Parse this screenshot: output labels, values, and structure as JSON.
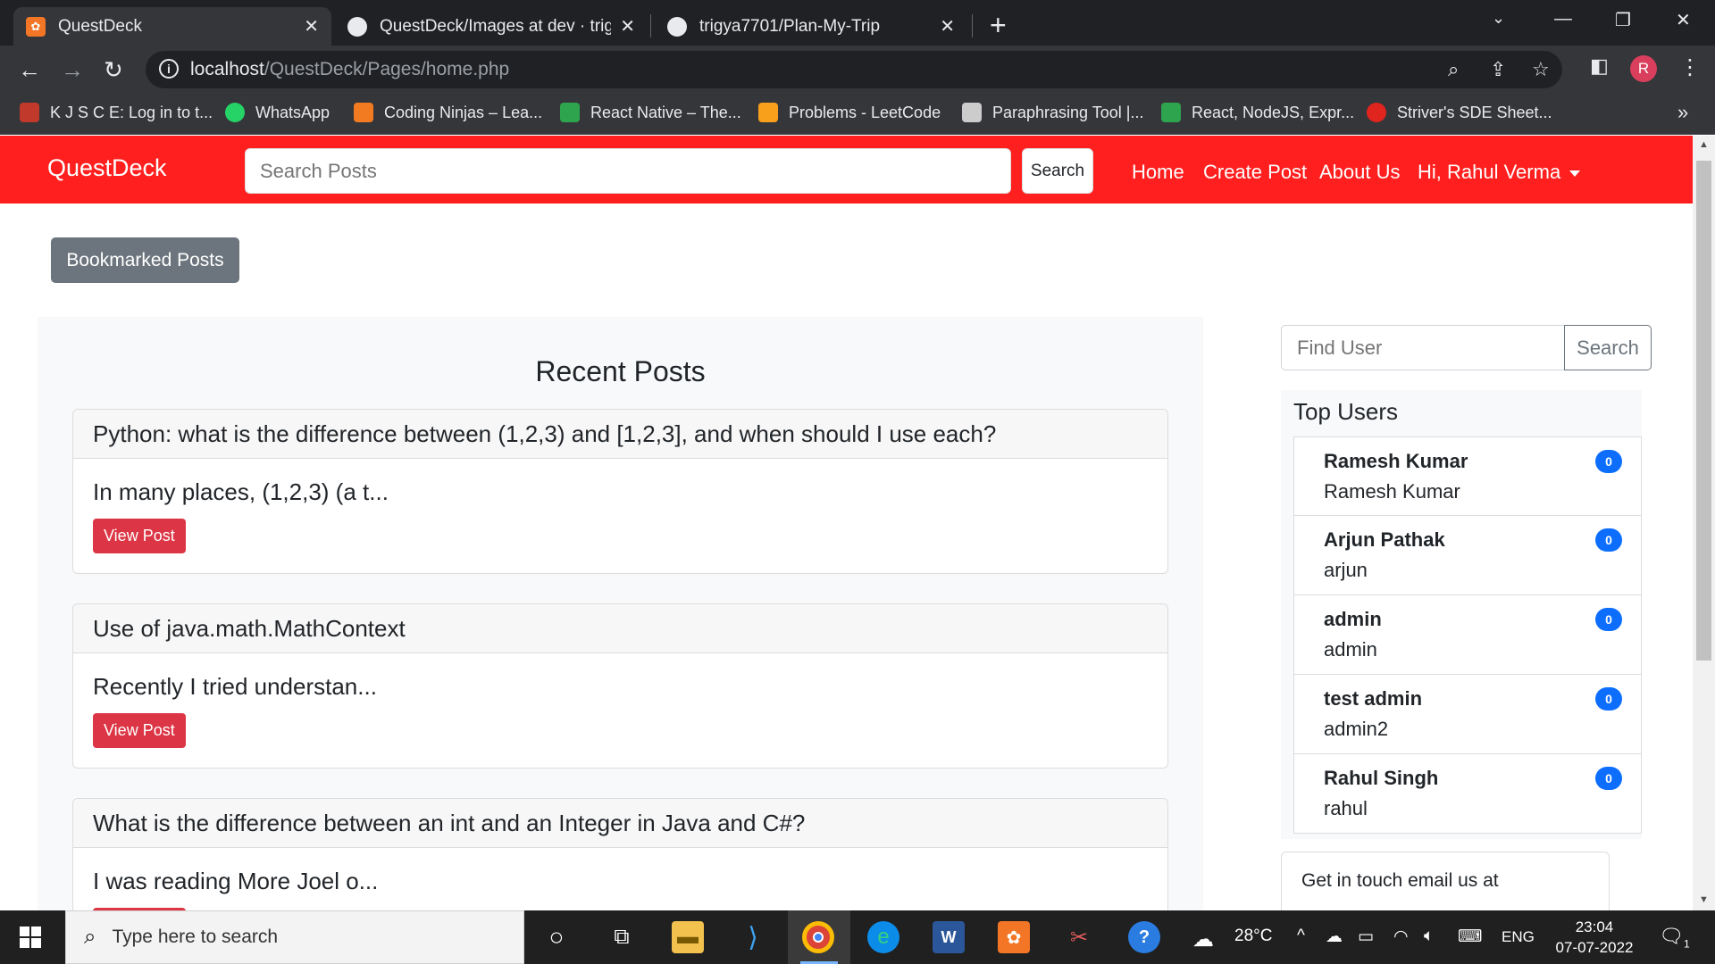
{
  "browser": {
    "tabs": [
      {
        "title": "QuestDeck",
        "active": true,
        "icon": "xampp-icon"
      },
      {
        "title": "QuestDeck/Images at dev · trigya",
        "active": false,
        "icon": "github-icon"
      },
      {
        "title": "trigya7701/Plan-My-Trip",
        "active": false,
        "icon": "github-icon"
      }
    ],
    "url_host": "localhost",
    "url_path": "/QuestDeck/Pages/home.php",
    "profile_initial": "R",
    "bookmarks": [
      {
        "label": "K J S C E: Log in to t...",
        "color": "#c0392b"
      },
      {
        "label": "WhatsApp",
        "color": "#25d366"
      },
      {
        "label": "Coding Ninjas – Lea...",
        "color": "#f27b21"
      },
      {
        "label": "React Native – The...",
        "color": "#2ea44f"
      },
      {
        "label": "Problems - LeetCode",
        "color": "#f89f1b"
      },
      {
        "label": "Paraphrasing Tool |...",
        "color": "#cccccc"
      },
      {
        "label": "React, NodeJS, Expr...",
        "color": "#2ea44f"
      },
      {
        "label": "Striver's SDE Sheet...",
        "color": "#e0241e"
      }
    ]
  },
  "navbar": {
    "brand": "QuestDeck",
    "search_placeholder": "Search Posts",
    "search_label": "Search",
    "links": [
      "Home",
      "Create Post",
      "About Us"
    ],
    "user_menu": "Hi, Rahul Verma"
  },
  "bookmarked_label": "Bookmarked Posts",
  "recent": {
    "title": "Recent Posts",
    "view_label": "View Post",
    "posts": [
      {
        "title": "Python: what is the difference between (1,2,3) and [1,2,3], and when should I use each?",
        "excerpt": "In many places, (1,2,3) (a t..."
      },
      {
        "title": "Use of java.math.MathContext",
        "excerpt": "Recently I tried understan..."
      },
      {
        "title": "What is the difference between an int and an Integer in Java and C#?",
        "excerpt": "I was reading More Joel o..."
      }
    ]
  },
  "sidebar": {
    "find_placeholder": "Find User",
    "find_label": "Search",
    "top_users_title": "Top Users",
    "users": [
      {
        "name": "Ramesh Kumar",
        "handle": "Ramesh Kumar",
        "count": "0"
      },
      {
        "name": "Arjun Pathak",
        "handle": "arjun",
        "count": "0"
      },
      {
        "name": "admin",
        "handle": "admin",
        "count": "0"
      },
      {
        "name": "test admin",
        "handle": "admin2",
        "count": "0"
      },
      {
        "name": "Rahul Singh",
        "handle": "rahul",
        "count": "0"
      }
    ],
    "contact_text": "Get in touch email us at"
  },
  "taskbar": {
    "search_placeholder": "Type here to search",
    "temperature": "28°C",
    "language": "ENG",
    "time": "23:04",
    "date": "07-07-2022",
    "notification_count": "1"
  },
  "colors": {
    "navbar": "#ff1f1f",
    "view_button": "#dc3545",
    "badge": "#0d6efd",
    "secondary_button": "#6c757d"
  }
}
